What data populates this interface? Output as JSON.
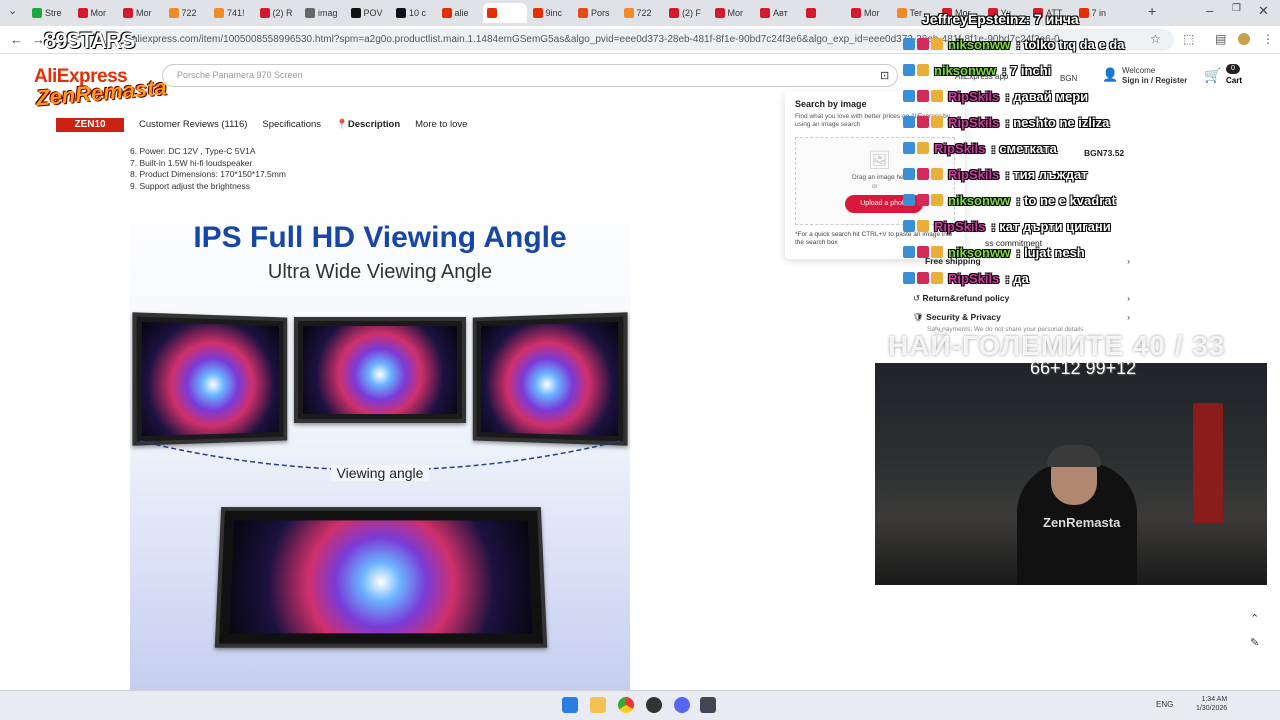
{
  "browser": {
    "tabs": [
      {
        "label": "Stre",
        "color": "#1aa83a"
      },
      {
        "label": "Mor",
        "color": "#d41a2c"
      },
      {
        "label": "Mor",
        "color": "#d41a2c"
      },
      {
        "label": "722",
        "color": "#f08b2a"
      },
      {
        "label": "741!",
        "color": "#f08b2a"
      },
      {
        "label": "(2) R",
        "color": "#d41a2c"
      },
      {
        "label": "imag",
        "color": "#666666"
      },
      {
        "label": "POV",
        "color": "#111111"
      },
      {
        "label": "10 c",
        "color": "#111111"
      },
      {
        "label": "alie",
        "color": "#e62e04"
      },
      {
        "label": "",
        "color": "#e62e04"
      },
      {
        "label": "9inc",
        "color": "#e62e04"
      },
      {
        "label": "Pors",
        "color": "#e64a19"
      },
      {
        "label": "722",
        "color": "#f08b2a"
      },
      {
        "label": "(2) F",
        "color": "#d41a2c"
      },
      {
        "label": "Mor",
        "color": "#d41a2c"
      },
      {
        "label": "Авт",
        "color": "#d41a2c"
      },
      {
        "label": "",
        "color": "#d41a2c"
      },
      {
        "label": "Mor",
        "color": "#d41a2c"
      },
      {
        "label": "Ter",
        "color": "#f08b2a"
      },
      {
        "label": "Mor",
        "color": "#d41a2c"
      },
      {
        "label": "Уч",
        "color": "#d41a2c"
      },
      {
        "label": "ATT",
        "color": "#d41a2c"
      },
      {
        "label": "7 in",
        "color": "#e62e04"
      }
    ],
    "url": "aliexpress.com/item/1005008558996530.html?spm=a2g0o.productlist.main.1.1484emGSemG5as&algo_pvid=eee0d373-28eb-481f-8f1e-90bd7c24f3e6&algo_exp_id=eee0d373-28eb-481f-8f1e-90bd7c24f3e6-0"
  },
  "site": {
    "logo": "AliExpress",
    "search_placeholder": "Porsche Panamera 970 Screen",
    "app_label": "AliExpress app",
    "lang": "BGN",
    "welcome": "Welcome",
    "signin": "Sign in / Register",
    "cart": "Cart",
    "cart_count": "0"
  },
  "product_nav": {
    "reviews": "Customer Reviews (1116)",
    "specs": "Specifications",
    "description": "Description",
    "more": "More to love"
  },
  "specs": {
    "line6": "6. Power: DC 12V , Type-C  5V1A",
    "line7": "7. Built-in 1.5W hi-fi loudspeaker",
    "line8": "8. Product Dimensions: 170*150*17.5mm",
    "line9": "9. Support adjust the brightness"
  },
  "description_image": {
    "headline": "IPS Full HD Viewing Angle",
    "subheadline": "Ultra Wide Viewing Angle",
    "viewing_angle_label": "Viewing angle"
  },
  "search_by_image": {
    "title": "Search by image",
    "subtitle": "Find what you love with better prices on AliExpress by using an image search",
    "drag_text": "Drag an image here",
    "or": "or",
    "upload": "Upload a photo",
    "quick_tip": "*For a quick search hit CTRL+V to paste an image into the search box"
  },
  "side_panel": {
    "price": "BGN73.52",
    "commitment": "ss commitment",
    "free_shipping": "Free shipping",
    "return_policy": "Return&refund policy",
    "security": "Security & Privacy",
    "security_sub": "Safe payments: We do not share your personal details"
  },
  "stream_overlay": {
    "stars": "89STARS",
    "channel": "ZenRemasta",
    "zen10": "ZEN10",
    "top_message": {
      "user": "JeffreyEpsteinz",
      "text": ": 7 инча"
    },
    "chat": [
      {
        "user": "niksonww",
        "text": ": tolko trq da e da",
        "color": "#7fdc3a"
      },
      {
        "user": "niksonww",
        "text": ": 7 inchi",
        "color": "#7fdc3a"
      },
      {
        "user": "RipSkils",
        "text": ": давай мери",
        "color": "#d23aa6"
      },
      {
        "user": "RipSkils",
        "text": ": neshto ne izliza",
        "color": "#d23aa6"
      },
      {
        "user": "RipSkils",
        "text": ": сметката",
        "color": "#d23aa6"
      },
      {
        "user": "RipSkils",
        "text": ": тия лъждат",
        "color": "#d23aa6"
      },
      {
        "user": "niksonww",
        "text": ": to ne e kvadrat",
        "color": "#7fdc3a"
      },
      {
        "user": "RipSkils",
        "text": ": кат дърти цигани",
        "color": "#d23aa6"
      },
      {
        "user": "niksonww",
        "text": ": lujat nesh",
        "color": "#7fdc3a"
      },
      {
        "user": "RipSkils",
        "text": ": да",
        "color": "#d23aa6"
      }
    ],
    "big_text": "НАЙ-ГОЛЕМИТЕ 40 / 33",
    "score": "66+12 99+12",
    "cam_logo": "ZenRemasta"
  },
  "taskbar": {
    "lang": "ENG",
    "time": "1:34 AM",
    "date": "1/30/2026"
  }
}
